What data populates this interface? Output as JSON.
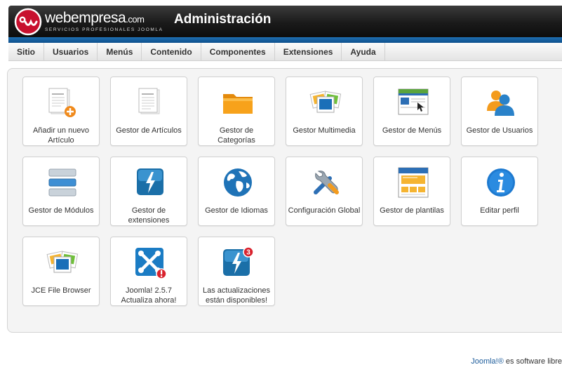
{
  "header": {
    "logo_word": "webempresa",
    "logo_suffix": ".com",
    "logo_tagline": "SERVICIOS PROFESIONALES JOOMLA",
    "title": "Administración"
  },
  "menu": [
    "Sitio",
    "Usuarios",
    "Menús",
    "Contenido",
    "Componentes",
    "Extensiones",
    "Ayuda"
  ],
  "tiles": [
    {
      "label": "Añadir un nuevo Artículo",
      "icon": "add-article-icon"
    },
    {
      "label": "Gestor de Artículos",
      "icon": "article-icon"
    },
    {
      "label": "Gestor de Categorías",
      "icon": "folder-icon"
    },
    {
      "label": "Gestor Multimedia",
      "icon": "media-icon"
    },
    {
      "label": "Gestor de Menús",
      "icon": "menu-window-icon"
    },
    {
      "label": "Gestor de Usuarios",
      "icon": "users-icon"
    },
    {
      "label": "Gestor de Módulos",
      "icon": "modules-icon"
    },
    {
      "label": "Gestor de extensiones",
      "icon": "extensions-icon"
    },
    {
      "label": "Gestor de Idiomas",
      "icon": "globe-icon"
    },
    {
      "label": "Configuración Global",
      "icon": "tools-icon"
    },
    {
      "label": "Gestor de plantilas",
      "icon": "template-icon"
    },
    {
      "label": "Editar perfil",
      "icon": "info-icon"
    },
    {
      "label": "JCE File Browser",
      "icon": "media-icon"
    },
    {
      "label": "Joomla! 2.5.7 Actualiza ahora!",
      "icon": "joomla-update-icon"
    },
    {
      "label": "Las actualizaciones están disponibles!",
      "icon": "extension-updates-icon"
    }
  ],
  "update_badge_count": "3",
  "footer": {
    "link": "Joomla!®",
    "text": " es software libre"
  },
  "colors": {
    "header_dark": "#1a1a1a",
    "header_blue": "#1f6fb2",
    "logo_red": "#c8102e",
    "folder_orange": "#f7a21b",
    "link_blue": "#1a5a9a"
  }
}
